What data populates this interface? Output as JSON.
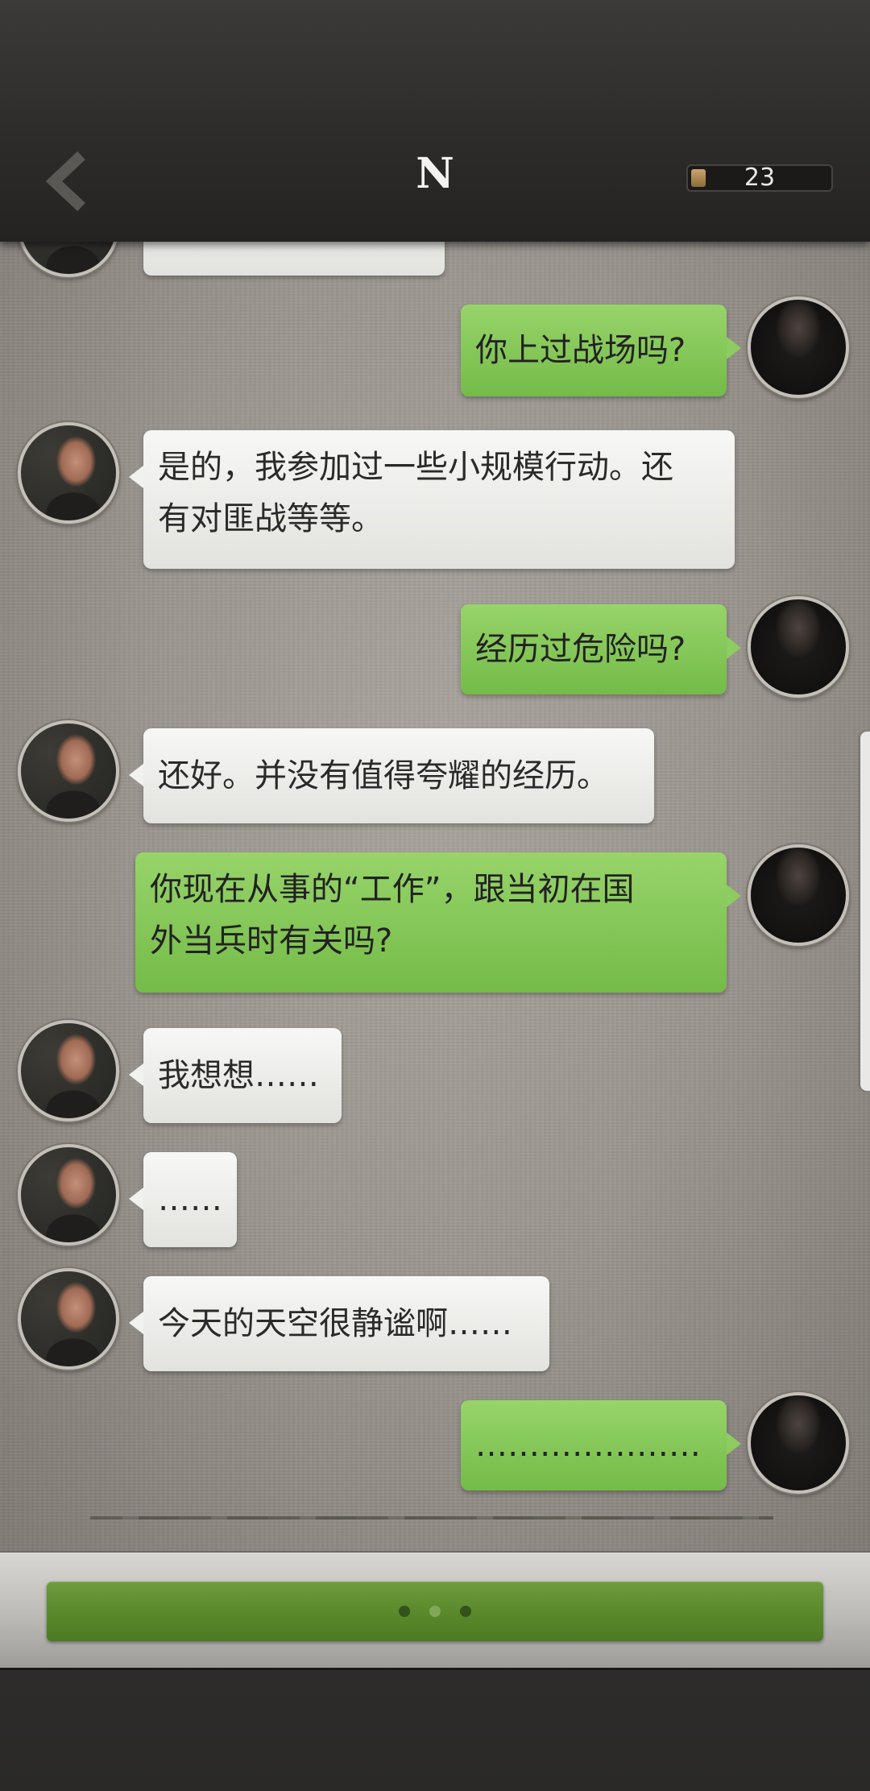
{
  "header": {
    "back_icon": "chevron-left-icon",
    "title": "N",
    "counter_value": "23"
  },
  "messages": [
    {
      "sender": "me",
      "text": "你上过战场吗?"
    },
    {
      "sender": "npc",
      "text": "是的，我参加过一些小规模行动。还\n有对匪战等等。"
    },
    {
      "sender": "me",
      "text": "经历过危险吗?"
    },
    {
      "sender": "npc",
      "text": "还好。并没有值得夸耀的经历。"
    },
    {
      "sender": "me",
      "text": "你现在从事的“工作”，跟当初在国\n外当兵时有关吗?"
    },
    {
      "sender": "npc",
      "text": "我想想……"
    },
    {
      "sender": "npc",
      "text": "……"
    },
    {
      "sender": "npc",
      "text": "今天的天空很静谧啊……"
    },
    {
      "sender": "me",
      "text": "…………………"
    }
  ],
  "bottom": {
    "reply_indicator": "typing-dots"
  },
  "colors": {
    "header_bg": "#2c2b2a",
    "me_bubble": "#86c55a",
    "npc_bubble": "#ededeb",
    "reply_button": "#5a8a2c"
  }
}
